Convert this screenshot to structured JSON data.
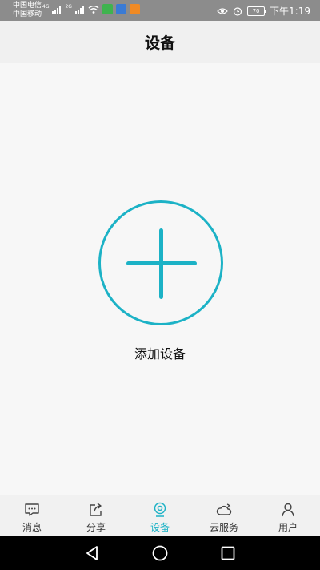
{
  "status_bar": {
    "carrier_1": "中国电信",
    "carrier_2": "中国移动",
    "net_1": "4G",
    "net_2": "2G",
    "battery": "70",
    "time": "下午1:19"
  },
  "header": {
    "title": "设备"
  },
  "main": {
    "add_label": "添加设备",
    "accent_color": "#1cb2c6"
  },
  "tabs": [
    {
      "label": "消息",
      "icon": "message-icon",
      "active": false
    },
    {
      "label": "分享",
      "icon": "share-icon",
      "active": false
    },
    {
      "label": "设备",
      "icon": "camera-icon",
      "active": true
    },
    {
      "label": "云服务",
      "icon": "cloud-icon",
      "active": false
    },
    {
      "label": "用户",
      "icon": "user-icon",
      "active": false
    }
  ],
  "nav": {
    "back_icon": "back-triangle-icon",
    "home_icon": "home-circle-icon",
    "recents_icon": "recents-square-icon"
  }
}
